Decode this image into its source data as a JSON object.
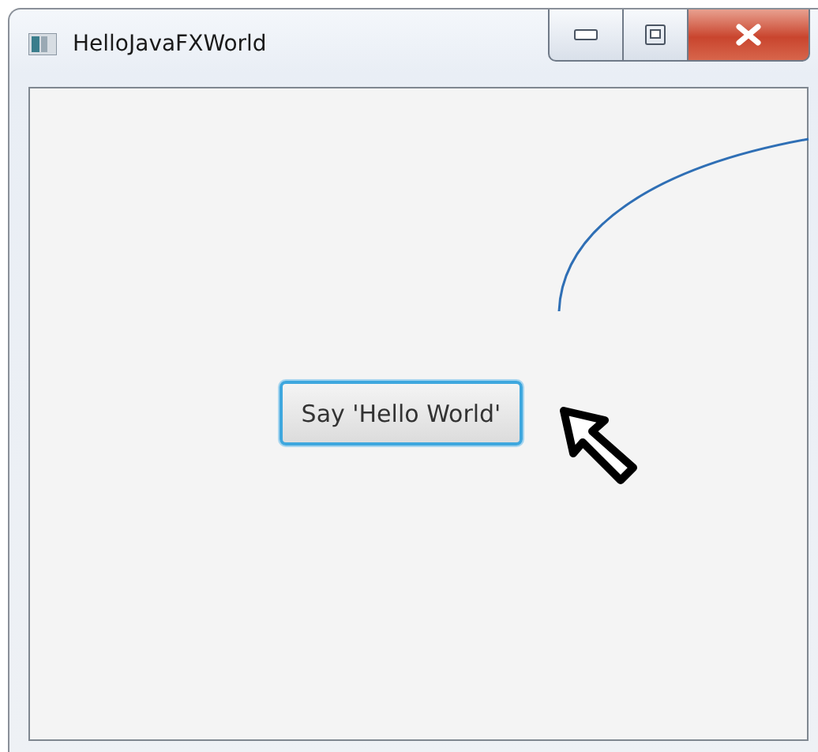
{
  "window": {
    "title": "HelloJavaFXWorld"
  },
  "button": {
    "label": "Say 'Hello World'",
    "focused": true
  }
}
